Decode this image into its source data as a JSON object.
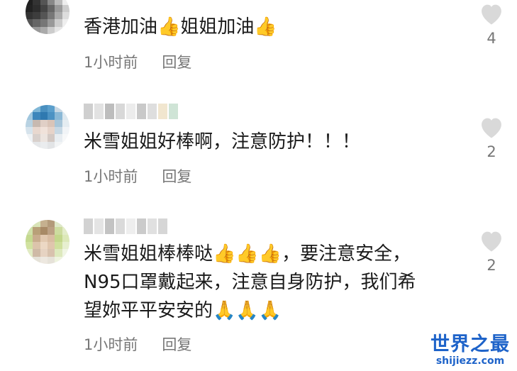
{
  "comments": [
    {
      "text": "香港加油👍姐姐加油👍",
      "time": "1小时前",
      "reply_label": "回复",
      "likes": "4"
    },
    {
      "text": "米雪姐姐好棒啊，注意防护！！！",
      "time": "1小时前",
      "reply_label": "回复",
      "likes": "2"
    },
    {
      "text": "米雪姐姐棒棒哒👍👍👍，要注意安全，\nN95口罩戴起来，注意自身防护，我们希\n望妳平平安安的🙏🙏🙏",
      "time": "1小时前",
      "reply_label": "回复",
      "likes": "2"
    }
  ],
  "watermark": {
    "main": "世界之最",
    "sub": "shijiezz.com"
  },
  "icons": {
    "like": "heart-icon"
  },
  "colors": {
    "meta": "#777777",
    "text": "#1a1a1a",
    "heart": "#d9d9d9",
    "watermark": "#1e63c9"
  }
}
